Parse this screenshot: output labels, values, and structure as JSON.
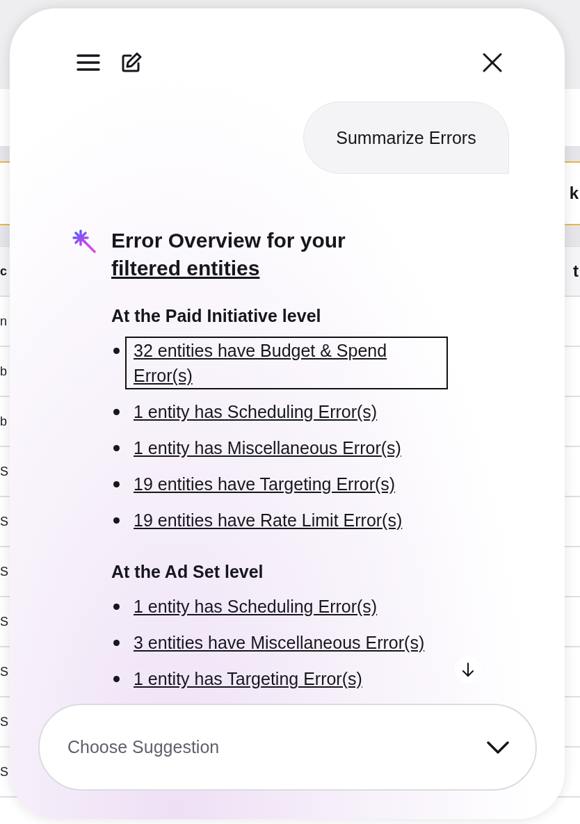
{
  "background": {
    "right_texts": [
      "k",
      "t"
    ],
    "left_texts": [
      "c",
      "n",
      "b",
      "b",
      "S",
      "S",
      "S",
      "S",
      "S",
      "S",
      "S"
    ]
  },
  "assistant_panel": {
    "user_message": "Summarize Errors",
    "heading": {
      "text": "Error Overview for your",
      "link": "filtered entities"
    },
    "sections": [
      {
        "title": "At the Paid Initiative level",
        "items": [
          {
            "text": "32 entities have Budget & Spend Error(s)",
            "focused": true
          },
          {
            "text": "1 entity has Scheduling Error(s)",
            "focused": false
          },
          {
            "text": "1 entity has Miscellaneous Error(s)",
            "focused": false
          },
          {
            "text": "19 entities have Targeting Error(s)",
            "focused": false
          },
          {
            "text": "19 entities have Rate Limit Error(s)",
            "focused": false
          }
        ]
      },
      {
        "title": "At the Ad Set level",
        "items": [
          {
            "text": "1 entity has Scheduling Error(s)",
            "focused": false
          },
          {
            "text": "3 entities have Miscellaneous Error(s)",
            "focused": false
          },
          {
            "text": "1 entity has Targeting Error(s)",
            "focused": false
          }
        ]
      }
    ],
    "suggestion_field": {
      "placeholder": "Choose Suggestion"
    }
  }
}
